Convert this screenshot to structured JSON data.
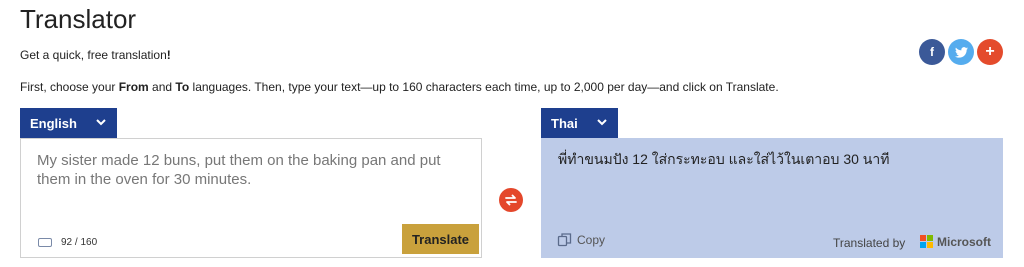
{
  "header": {
    "title": "Translator",
    "subtitle_lead": "Get a quick, free translation",
    "subtitle_mark": "!",
    "instructions": {
      "part1": "First, choose your ",
      "from_word": "From",
      "part2": " and ",
      "to_word": "To",
      "part3": " languages. Then, type your text—up to 160 characters each time, up to 2,000 per day—and click on Translate."
    }
  },
  "share": {
    "facebook_label": "f",
    "twitter_icon": "twitter-bird-icon",
    "more_label": "+",
    "colors": {
      "facebook": "#3b5998",
      "twitter": "#55acee",
      "more": "#e44b2c"
    }
  },
  "source": {
    "language": "English",
    "text": "My sister made 12 buns, put them on the baking pan and put them in the oven for 30 minutes.",
    "counter": "92 / 160",
    "translate_label": "Translate"
  },
  "target": {
    "language": "Thai",
    "text": "พี่ทำขนมปัง 12 ใส่กระทะอบ และใส่ไว้ในเตาอบ 30 นาที",
    "copy_label": "Copy",
    "translated_by": "Translated by",
    "provider": "Microsoft"
  },
  "colors": {
    "language_button": "#1e3f8e",
    "translate_button": "#c9a13c",
    "swap_button": "#e4472b",
    "target_background": "#bdcbe8"
  }
}
